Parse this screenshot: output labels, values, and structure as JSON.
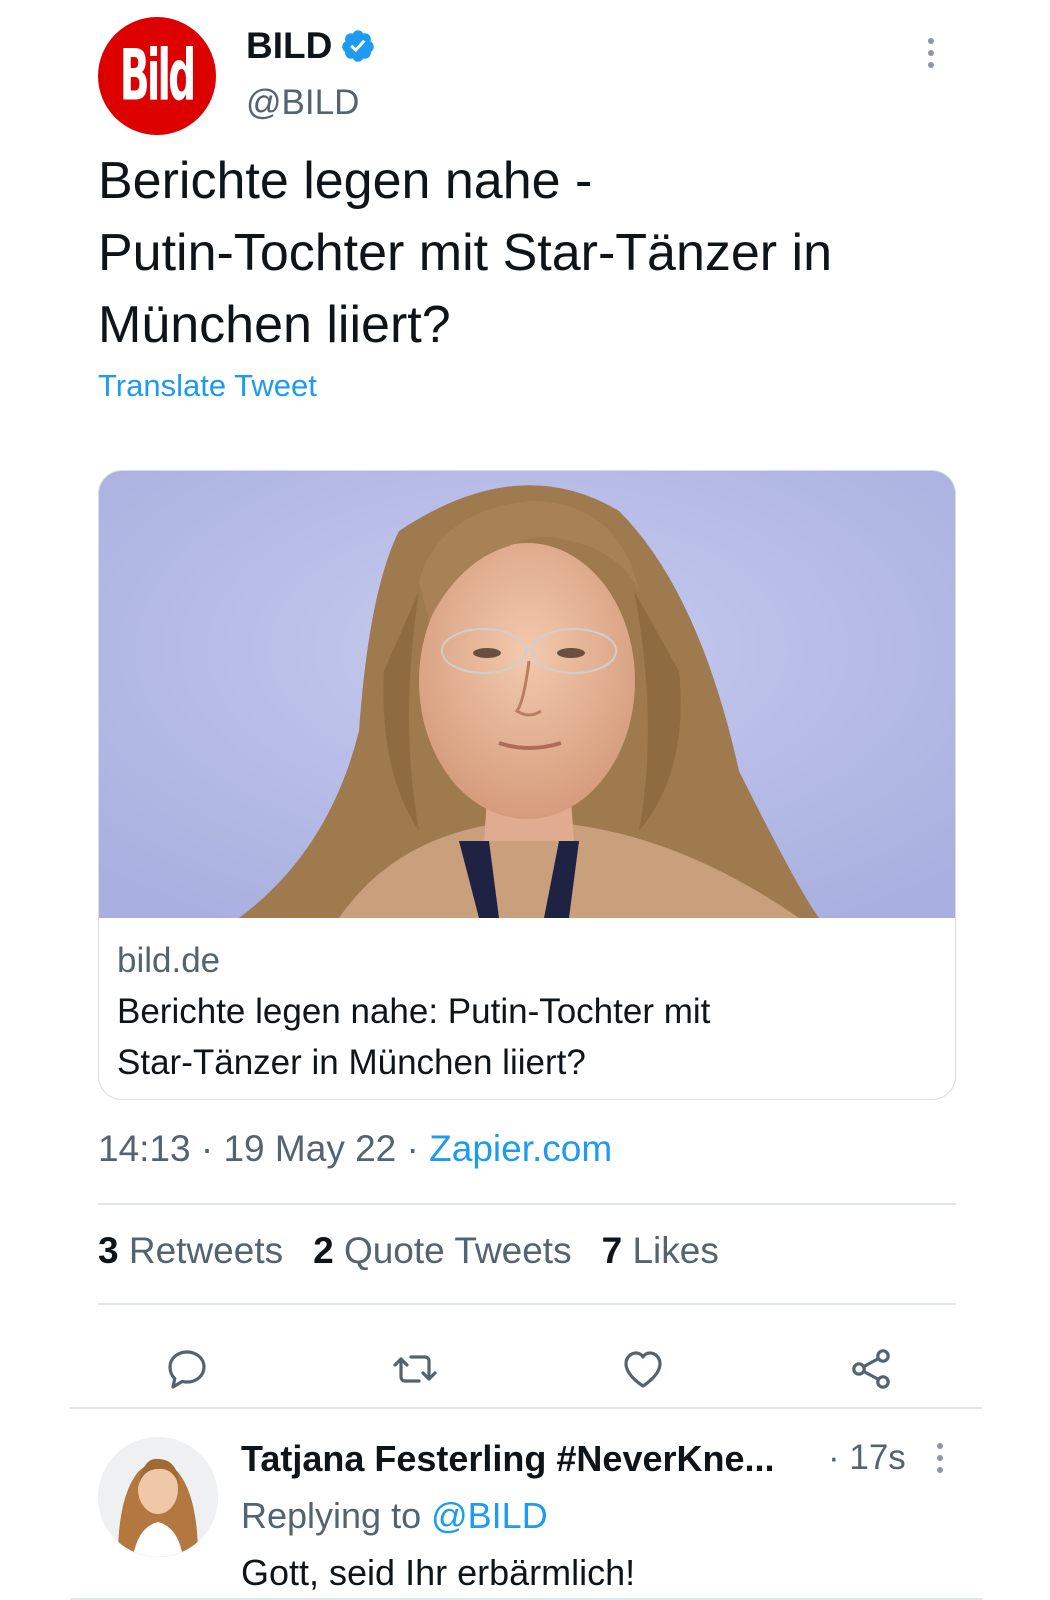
{
  "tweet": {
    "author": {
      "name": "BILD",
      "handle": "@BILD",
      "avatar_logo_text": "Bild",
      "brand_color": "#dd0000",
      "verified_icon": "verified-badge-icon",
      "verified_color": "#1d9bf0"
    },
    "text_lines": [
      "Berichte legen nahe -",
      "Putin-Tochter mit Star-Tänzer in",
      "München liiert?"
    ],
    "translate_label": "Translate Tweet",
    "card": {
      "image_icon": "portrait-photo-icon",
      "domain": "bild.de",
      "title_lines": [
        "Berichte legen nahe: Putin-Tochter mit",
        "Star-Tänzer in München liiert?"
      ]
    },
    "meta": {
      "time": "14:13",
      "date": "19 May 22",
      "source": "Zapier.com",
      "separator": " · "
    },
    "stats": {
      "retweets_count": "3",
      "retweets_label": "Retweets",
      "quotes_count": "2",
      "quotes_label": "Quote Tweets",
      "likes_count": "7",
      "likes_label": "Likes"
    },
    "actions": [
      {
        "name": "reply",
        "icon": "reply-icon"
      },
      {
        "name": "retweet",
        "icon": "retweet-icon"
      },
      {
        "name": "like",
        "icon": "heart-icon"
      },
      {
        "name": "share",
        "icon": "share-icon"
      }
    ]
  },
  "reply": {
    "author_name": "Tatjana Festerling #NeverKne...",
    "time": "· 17s",
    "replying_prefix": "Replying to",
    "replying_to": "@BILD",
    "text": "Gott, seid Ihr erbärmlich!"
  },
  "colors": {
    "accent": "#1d9bf0",
    "secondary_text": "#536471",
    "primary_text": "#0f1419",
    "divider": "#e1e6ea"
  }
}
